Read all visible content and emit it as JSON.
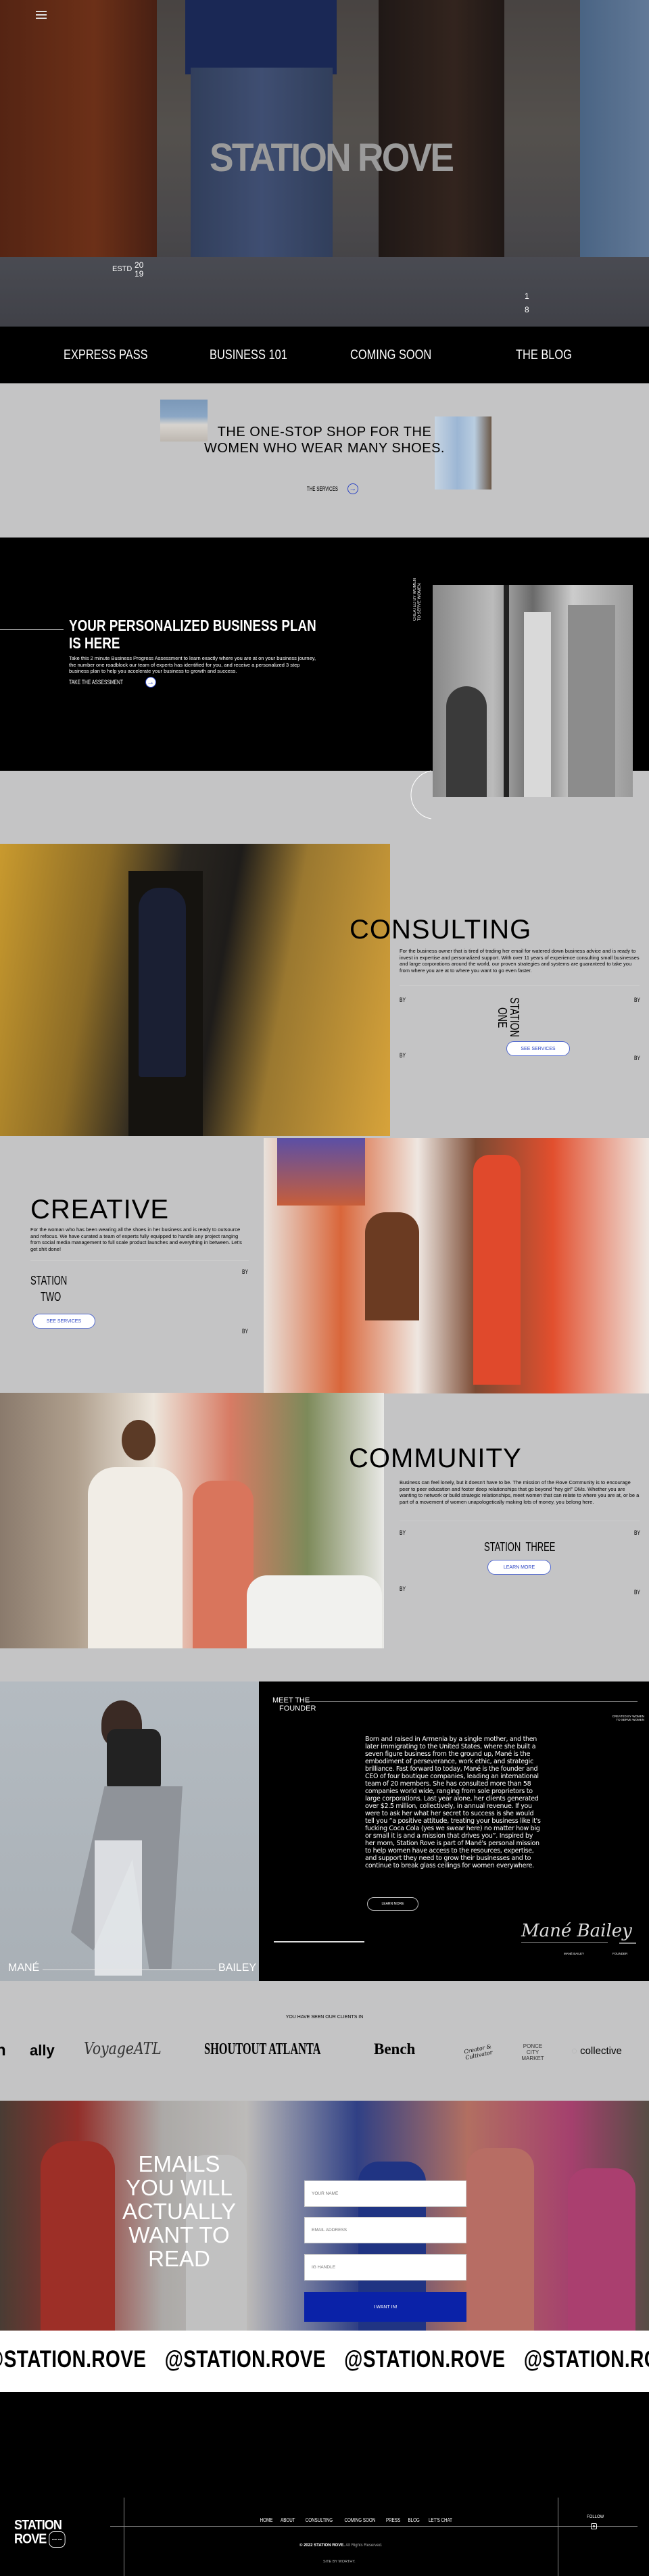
{
  "brand": {
    "name": "STATION ROVE",
    "footer_logo_line1": "STATION",
    "footer_logo_line2": "ROVE",
    "footer_logo_badge": "ESTD. 2019"
  },
  "hero": {
    "title": "STATION ROVE",
    "estd_label": "ESTD",
    "estd_year_top": "20",
    "estd_year_bottom": "19",
    "side_num_top": "1",
    "side_num_bottom": "8",
    "menu_icon": "hamburger-menu-icon"
  },
  "nav": {
    "items": [
      {
        "label": "EXPRESS PASS"
      },
      {
        "label": "BUSINESS 101"
      },
      {
        "label": "COMING SOON"
      },
      {
        "label": "THE BLOG"
      }
    ]
  },
  "intro": {
    "headline_line1": "THE ONE-STOP SHOP FOR THE",
    "headline_line2": "WOMEN WHO WEAR MANY SHOES.",
    "cta_label": "THE SERVICES"
  },
  "assessment": {
    "title_line1": "YOUR PERSONALIZED BUSINESS PLAN",
    "title_line2": "IS HERE",
    "body": "Take this 2 minute Business Progress Assessment to learn exactly where you are at on your business journey, the number one roadblock our team of experts has identified for you, and receive a personalized 3 step business plan to help you accelerate your business to growth and success.",
    "cta_label": "TAKE THE ASSESSMENT",
    "vertical_line1": "CREATED BY WOMEN",
    "vertical_line2": "TO SERVE WOMEN"
  },
  "services": [
    {
      "title": "CONSULTING",
      "body": "For the business owner that is tired of trading her email for watered down business advice and is ready to invest in expertise and personalized support. With over 11 years of experience consulting small businesses and large corporations around the world, our proven strategies and systems are guaranteed to take you from where you are at to where you want to go even faster.",
      "station_word": "STATION",
      "station_num": "ONE",
      "by_label": "BY",
      "button_label": "SEE SERVICES"
    },
    {
      "title": "CREATIVE",
      "body": "For the woman who has been wearing all the shoes in her business and is ready to outsource and refocus. We have curated a team of experts fully equipped to handle any project ranging from social media management to full scale product launches and everything in between. Let's get shit done!",
      "station_word": "STATION",
      "station_num": "TWO",
      "by_label": "BY",
      "button_label": "SEE SERVICES"
    },
    {
      "title": "COMMUNITY",
      "body": "Business can feel lonely, but it doesn't have to be. The mission of the Rove Community is to encourage peer to peer education and foster deep relationships that go beyond “hey girl” DMs. Whether you are wanting to network or build strategic relationships, meet women that can relate to where you are at, or be a part of a movement of women unapologetically making lots of money, you belong here.",
      "station_word": "STATION",
      "station_num": "THREE",
      "by_label": "BY",
      "button_label": "LEARN MORE"
    }
  ],
  "founder": {
    "heading_line1": "MEET THE",
    "heading_line2": "FOUNDER",
    "tagline_line1": "CREATED BY WOMEN",
    "tagline_line2": "TO SERVE WOMEN",
    "first_name": "MANÉ",
    "last_name": "BAILEY",
    "bio": "Born and raised in Armenia by a single mother, and then later immigrating to the United States, where she built a seven figure business from the ground up, Mané is the embodiment of perseverance, work ethic, and strategic brilliance. Fast forward to today, Mané is the founder and CEO of four boutique companies, leading an international team of 20 members. She has consulted more than 58 companies world wide, ranging from sole proprietors to large corporations. Last year alone, her clients generated over $2.5 million, collectively, in annual revenue. If you were to ask her what her secret to success is she would tell you “a positive attitude, treating your business like it's fucking Coca Cola (yes we swear here) no matter how big or small it is and a mission that drives you”. Inspired by her mom, Station Rove is part of Mané's personal mission to help women have access to the resources, expertise, and support they need to grow their businesses and to continue to break glass ceilings for women everywhere.",
    "button_label": "LEARN MORE",
    "signature": "Mané Bailey",
    "signature_name": "MANÉ BAILEY",
    "signature_role": "FOUNDER"
  },
  "clients": {
    "heading": "YOU HAVE SEEN OUR CLIENTS IN",
    "logos": [
      "n",
      "ally",
      "VoyageATL",
      "SHOUTOUT ATLANTA",
      "Bench",
      "Creator & Cultivator",
      "PONCE CITY MARKET",
      "collective"
    ]
  },
  "newsletter": {
    "title": "EMAILS YOU WILL ACTUALLY WANT TO READ",
    "name_placeholder": "YOUR NAME",
    "email_placeholder": "EMAIL ADDRESS",
    "ig_placeholder": "IG HANDLE",
    "submit_label": "I WANT IN!",
    "accent": "#0a22a8"
  },
  "marquee": {
    "handle": "@STATION.ROVE"
  },
  "footer": {
    "links": [
      "HOME",
      "ABOUT",
      "CONSULTING",
      "COMING SOON",
      "PRESS",
      "BLOG",
      "LET'S CHAT"
    ],
    "follow_label": "FOLLOW",
    "copyright_bold": "© 2022 STATION ROVE.",
    "copyright_rest": "All Rights Reserved.",
    "credit": "SITE BY WORTHY."
  },
  "colors": {
    "accent_blue": "#2b44c4",
    "submit_blue": "#0a22a8",
    "black": "#000000"
  }
}
